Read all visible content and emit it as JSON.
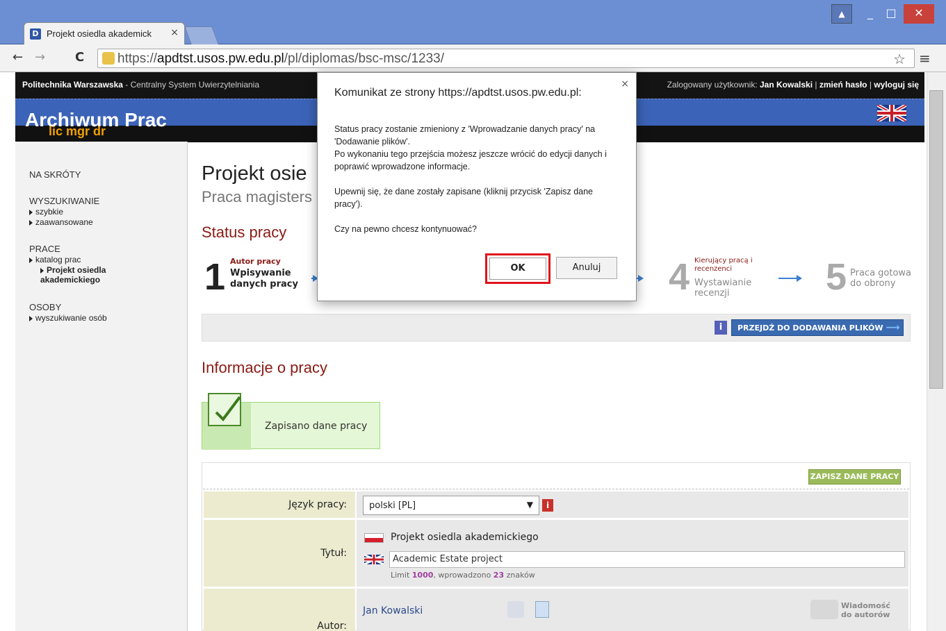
{
  "browser": {
    "tab_title": "Projekt osiedla akademick",
    "tab_close": "×",
    "favicon_letter": "D",
    "url_prefix": "https://",
    "url_domain": "apdtst.usos.pw.edu.pl",
    "url_path": "/pl/diplomas/bsc-msc/1233/",
    "back_icon": "←",
    "forward_icon": "→",
    "reload_icon": "C",
    "star_icon": "☆",
    "menu_icon": "≡",
    "user_icon": "▲",
    "minimize_icon": "_",
    "maximize_icon": "□",
    "close_icon": "✕"
  },
  "topstrip": {
    "org": "Politechnika Warszawska",
    "system": " - Centralny System Uwierzytelniania",
    "logged_label": "Zalogowany użytkownik: ",
    "user": "Jan Kowalski",
    "sep": " | ",
    "change_password": "zmień hasło",
    "logout": "wyloguj się"
  },
  "banner": {
    "title": "Archiwum Prac",
    "subtitle": "lic mgr dr"
  },
  "sidebar": {
    "shortcuts": "NA SKRÓTY",
    "search": "WYSZUKIWANIE",
    "search_quick": "szybkie",
    "search_advanced": "zaawansowane",
    "works": "PRACE",
    "works_catalog": "katalog prac",
    "works_current": "Projekt osiedla akademickiego",
    "persons": "OSOBY",
    "persons_search": "wyszukiwanie osób"
  },
  "main": {
    "title": "Projekt osie",
    "subtitle": "Praca magisters",
    "status_heading": "Status pracy",
    "steps": {
      "s1_num": "1",
      "s1_small": "Autor pracy",
      "s1_label": "Wpisywanie danych pracy",
      "s4_num": "4",
      "s4_small": "Kierujący pracą i recenzenci",
      "s4_label": "Wystawianie recenzji",
      "s5_num": "5",
      "s5_label": "Praca gotowa do obrony"
    },
    "info_icon": "i",
    "next_button": "PRZEJDŹ DO DODAWANIA PLIKÓW",
    "info_heading": "Informacje o pracy",
    "saved_message": "Zapisano dane pracy",
    "save_button": "ZAPISZ DANE PRACY",
    "lang_label": "Język pracy:",
    "lang_value": "polski [PL]",
    "title_label": "Tytuł:",
    "title_pl": "Projekt osiedla akademickiego",
    "title_en": "Academic Estate project",
    "limit_prefix": "Limit ",
    "limit_value": "1000",
    "limit_mid": ", wprowadzono ",
    "limit_count": "23",
    "limit_suffix": " znaków",
    "author_label": "Autor:",
    "author_name": "Jan Kowalski",
    "message_label": "Wiadomość do autorów"
  },
  "dialog": {
    "title": "Komunikat ze strony https://apdtst.usos.pw.edu.pl:",
    "close": "×",
    "p1": "Status pracy zostanie zmieniony z 'Wprowadzanie danych pracy' na 'Dodawanie plików'.",
    "p2": "Po wykonaniu tego przejścia możesz jeszcze wrócić do edycji danych i poprawić wprowadzone informacje.",
    "p3": "Upewnij się, że dane zostały zapisane (kliknij przycisk 'Zapisz dane pracy').",
    "p4": "Czy na pewno chcesz kontynuować?",
    "ok": "OK",
    "cancel": "Anuluj"
  },
  "colors": {
    "accent_blue": "#3b63b7",
    "heading_red": "#8a1a14",
    "ok_highlight": "#e0141a"
  }
}
